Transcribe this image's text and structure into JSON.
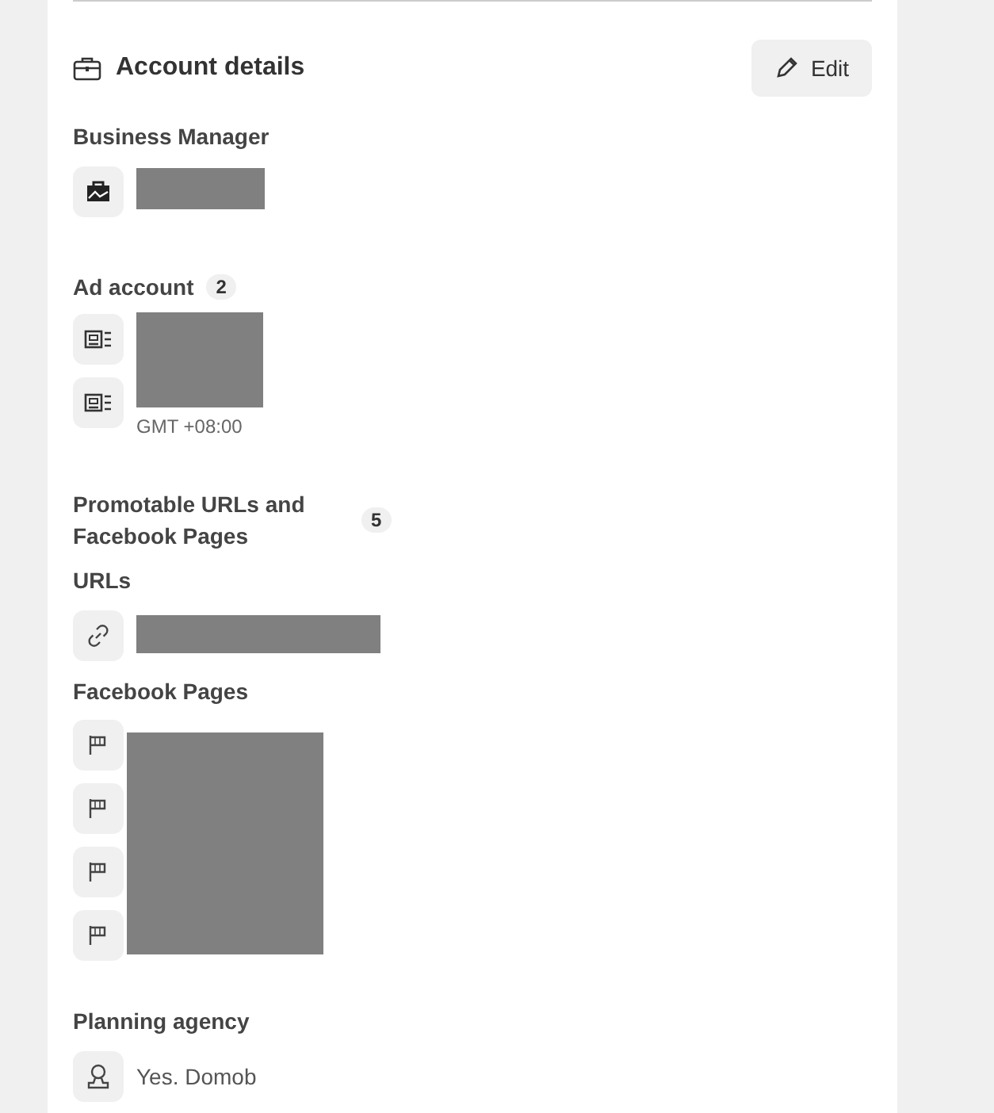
{
  "card": {
    "title": "Account details",
    "edit_button": "Edit"
  },
  "business_manager": {
    "label": "Business Manager"
  },
  "ad_account": {
    "label": "Ad account",
    "count": "2",
    "timezone": "GMT +08:00"
  },
  "promotable": {
    "label": "Promotable URLs and Facebook Pages",
    "count": "5",
    "urls_label": "URLs",
    "pages_label": "Facebook Pages",
    "pages": [
      {
        "kind": "facebook_page"
      },
      {
        "kind": "facebook_page"
      },
      {
        "kind": "facebook_page"
      },
      {
        "kind": "facebook_page"
      }
    ]
  },
  "planning_agency": {
    "label": "Planning agency",
    "value": "Yes. Domob"
  }
}
